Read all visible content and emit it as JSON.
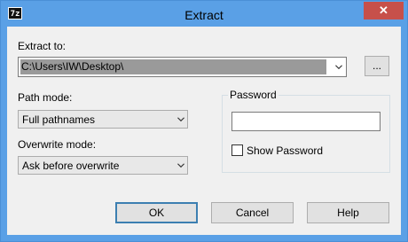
{
  "window": {
    "title": "Extract",
    "app_icon": "7z",
    "close_symbol": "✕"
  },
  "extract_to": {
    "label": "Extract to:",
    "value": "C:\\Users\\IW\\Desktop\\",
    "browse_label": "..."
  },
  "path_mode": {
    "label": "Path mode:",
    "value": "Full pathnames"
  },
  "overwrite_mode": {
    "label": "Overwrite mode:",
    "value": "Ask before overwrite"
  },
  "password": {
    "group_label": "Password",
    "value": "",
    "show_label": "Show Password",
    "show_checked": false
  },
  "buttons": {
    "ok": "OK",
    "cancel": "Cancel",
    "help": "Help"
  }
}
